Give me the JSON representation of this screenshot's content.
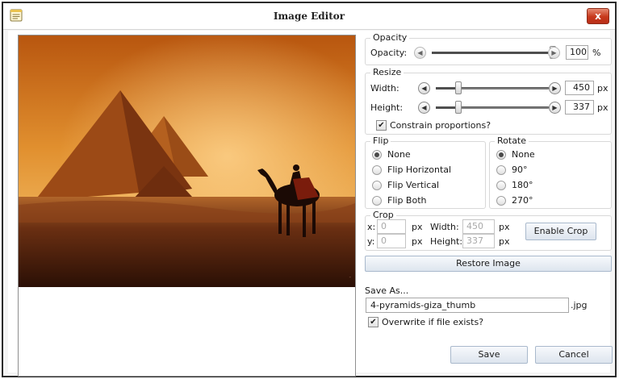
{
  "window": {
    "title": "Image Editor",
    "close_label": "x"
  },
  "opacity": {
    "legend": "Opacity",
    "label": "Opacity:",
    "value": "100",
    "unit": "%",
    "level": 1.0
  },
  "resize": {
    "legend": "Resize",
    "width_label": "Width:",
    "width_value": "450",
    "height_label": "Height:",
    "height_value": "337",
    "unit": "px",
    "width_level": 0.2,
    "height_level": 0.2,
    "constrain_label": "Constrain proportions?",
    "constrain_checked": true
  },
  "flip": {
    "legend": "Flip",
    "options": [
      "None",
      "Flip Horizontal",
      "Flip Vertical",
      "Flip Both"
    ],
    "selected": "None"
  },
  "rotate": {
    "legend": "Rotate",
    "options": [
      "None",
      "90°",
      "180°",
      "270°"
    ],
    "selected": "None"
  },
  "crop": {
    "legend": "Crop",
    "x_label": "x:",
    "x_value": "0",
    "y_label": "y:",
    "y_value": "0",
    "width_label": "Width:",
    "width_value": "450",
    "height_label": "Height:",
    "height_value": "337",
    "unit": "px",
    "enable_label": "Enable Crop"
  },
  "restore_label": "Restore Image",
  "save_as": {
    "label": "Save As...",
    "filename": "4-pyramids-giza_thumb",
    "extension": ".jpg",
    "overwrite_label": "Overwrite if file exists?",
    "overwrite_checked": true
  },
  "buttons": {
    "save": "Save",
    "cancel": "Cancel"
  },
  "check_mark": "✔"
}
